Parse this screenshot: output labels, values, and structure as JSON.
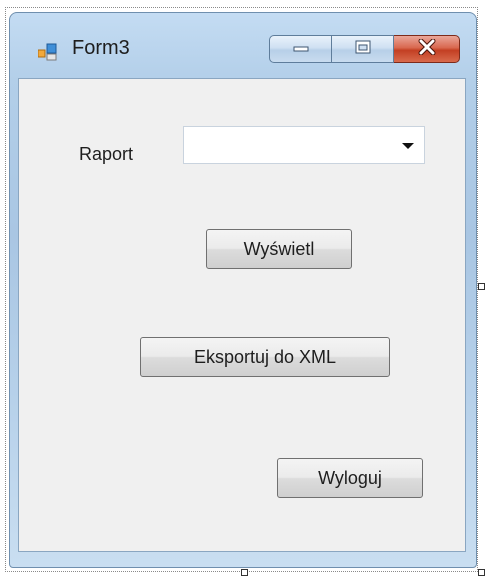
{
  "window": {
    "title": "Form3"
  },
  "titlebar": {
    "icons": {
      "app": "form-icon",
      "minimize": "minimize-icon",
      "maximize": "maximize-icon",
      "close": "close-icon"
    },
    "colors": {
      "close_button": "#c94a2c",
      "frame": "#b3cfe9"
    }
  },
  "form": {
    "raport_label": "Raport",
    "raport_combo_value": "",
    "buttons": {
      "show": "Wyświetl",
      "export": "Eksportuj do XML",
      "logout": "Wyloguj"
    }
  }
}
